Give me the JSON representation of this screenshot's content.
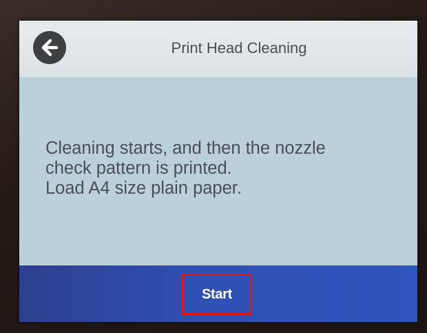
{
  "header": {
    "title": "Print Head Cleaning",
    "back_icon": "arrow-left-circle-icon"
  },
  "message": {
    "lines": [
      "Cleaning starts, and then the nozzle",
      "check pattern is printed.",
      "Load A4 size plain paper."
    ]
  },
  "footer": {
    "start_label": "Start",
    "highlight_color": "#e01818"
  },
  "colors": {
    "screen_bg": "#bcd0dc",
    "header_bg": "#e6ebee",
    "footer_bg": "#2f50b4",
    "text": "#4b4f55"
  }
}
